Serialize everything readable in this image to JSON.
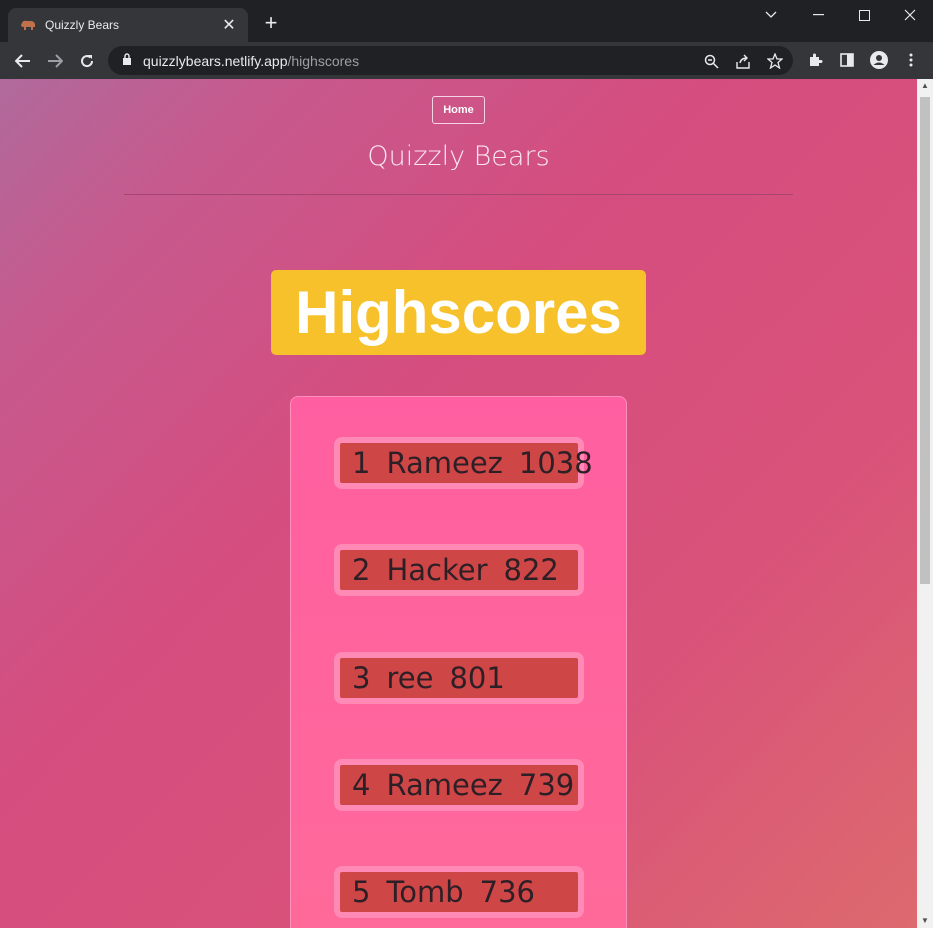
{
  "browser": {
    "tab_title": "Quizzly Bears",
    "tab_favicon": "bear-icon",
    "url_host": "quizzlybears.netlify.app",
    "url_path": "/highscores"
  },
  "page": {
    "home_label": "Home",
    "site_title": "Quizzly Bears",
    "banner": "Highscores",
    "scores": [
      {
        "rank": "1",
        "name": "Rameez",
        "score": "1038"
      },
      {
        "rank": "2",
        "name": "Hacker",
        "score": "822"
      },
      {
        "rank": "3",
        "name": "ree",
        "score": "801"
      },
      {
        "rank": "4",
        "name": "Rameez",
        "score": "739"
      },
      {
        "rank": "5",
        "name": "Tomb",
        "score": "736"
      }
    ]
  },
  "colors": {
    "banner": "#f6c12b",
    "board": "#ff5fa0",
    "row_fill": "#cf4647"
  }
}
